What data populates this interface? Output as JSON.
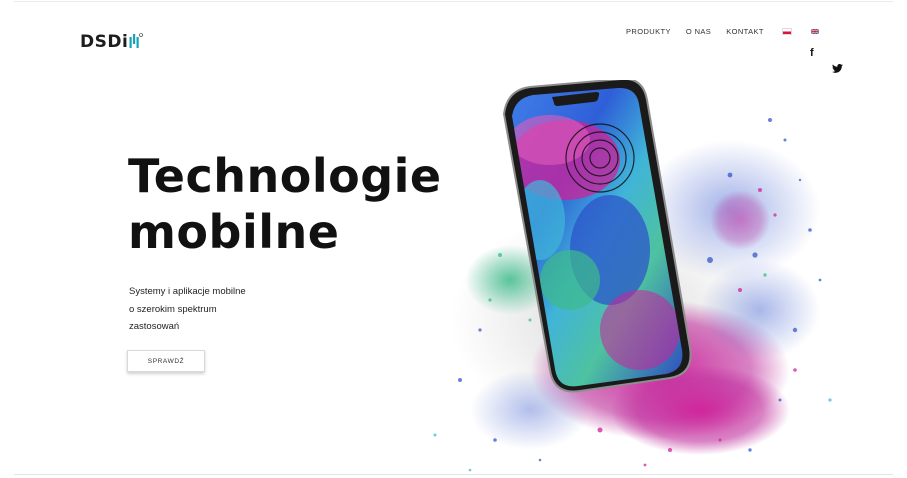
{
  "brand": {
    "logo_text": "DSDi"
  },
  "nav": {
    "items": [
      "PRODUKTY",
      "O NAS",
      "KONTAKT"
    ],
    "languages": [
      "pl",
      "en"
    ]
  },
  "social": {
    "facebook": "f"
  },
  "hero": {
    "title_line1": "Technologie",
    "title_line2": "mobilne",
    "subtitle_lines": [
      "Systemy i aplikacje mobilne",
      "o szerokim spektrum",
      "zastosowań"
    ],
    "cta_label": "SPRAWDŹ"
  },
  "colors": {
    "magenta": "#d0219a",
    "blue": "#2b4ec9",
    "cyan": "#3fb8d8",
    "green": "#3dbb8a",
    "teal_logo": "#1aa3b8"
  }
}
